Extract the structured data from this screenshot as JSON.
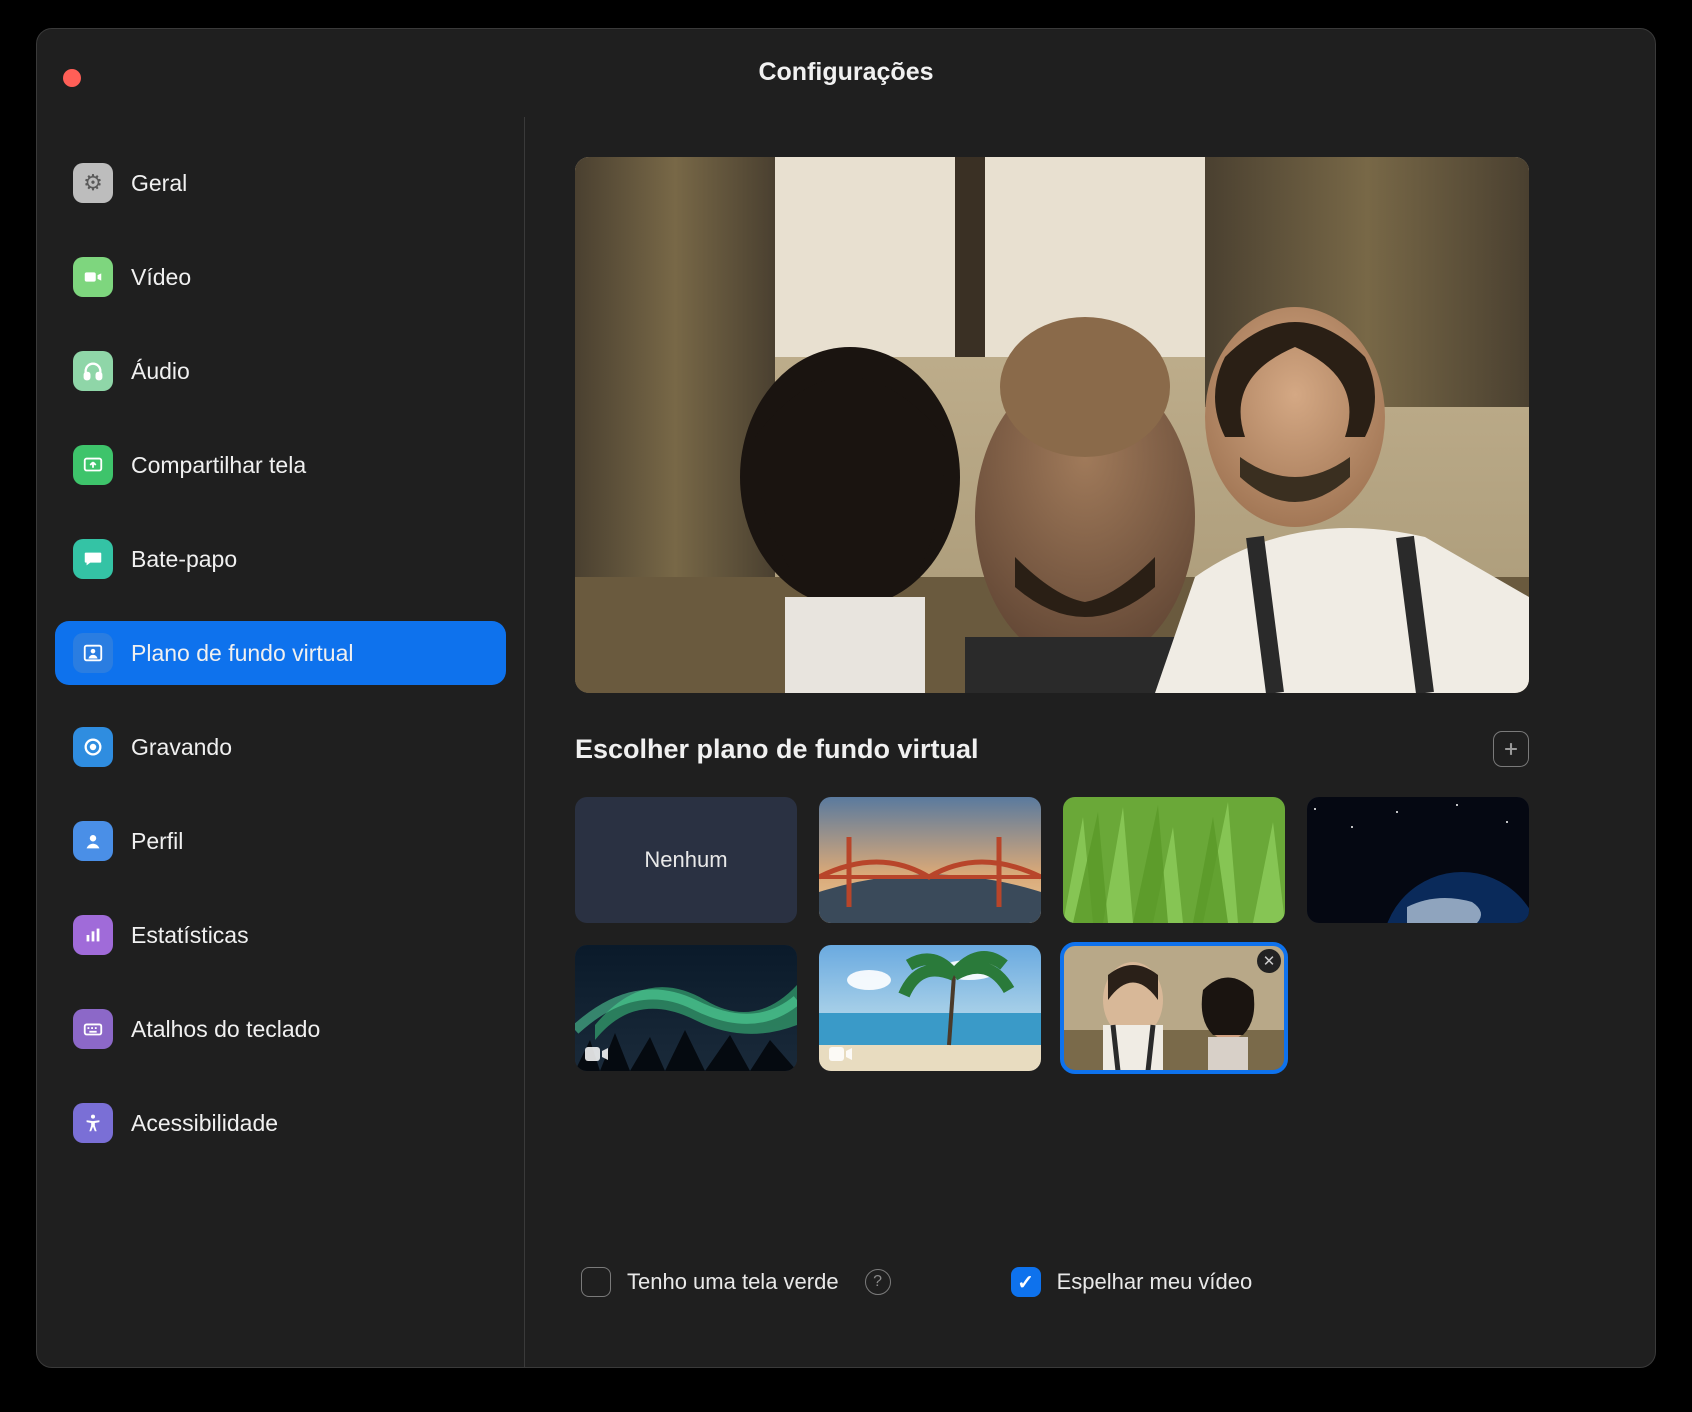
{
  "window": {
    "title": "Configurações"
  },
  "sidebar": {
    "items": [
      {
        "label": "Geral"
      },
      {
        "label": "Vídeo"
      },
      {
        "label": "Áudio"
      },
      {
        "label": "Compartilhar tela"
      },
      {
        "label": "Bate-papo"
      },
      {
        "label": "Plano de fundo virtual"
      },
      {
        "label": "Gravando"
      },
      {
        "label": "Perfil"
      },
      {
        "label": "Estatísticas"
      },
      {
        "label": "Atalhos do teclado"
      },
      {
        "label": "Acessibilidade"
      }
    ],
    "active_index": 5
  },
  "virtual_background": {
    "section_title": "Escolher plano de fundo virtual",
    "none_label": "Nenhum",
    "selected_index": 7,
    "greenscreen": {
      "label": "Tenho uma tela verde",
      "checked": false
    },
    "mirror": {
      "label": "Espelhar meu vídeo",
      "checked": true
    }
  }
}
